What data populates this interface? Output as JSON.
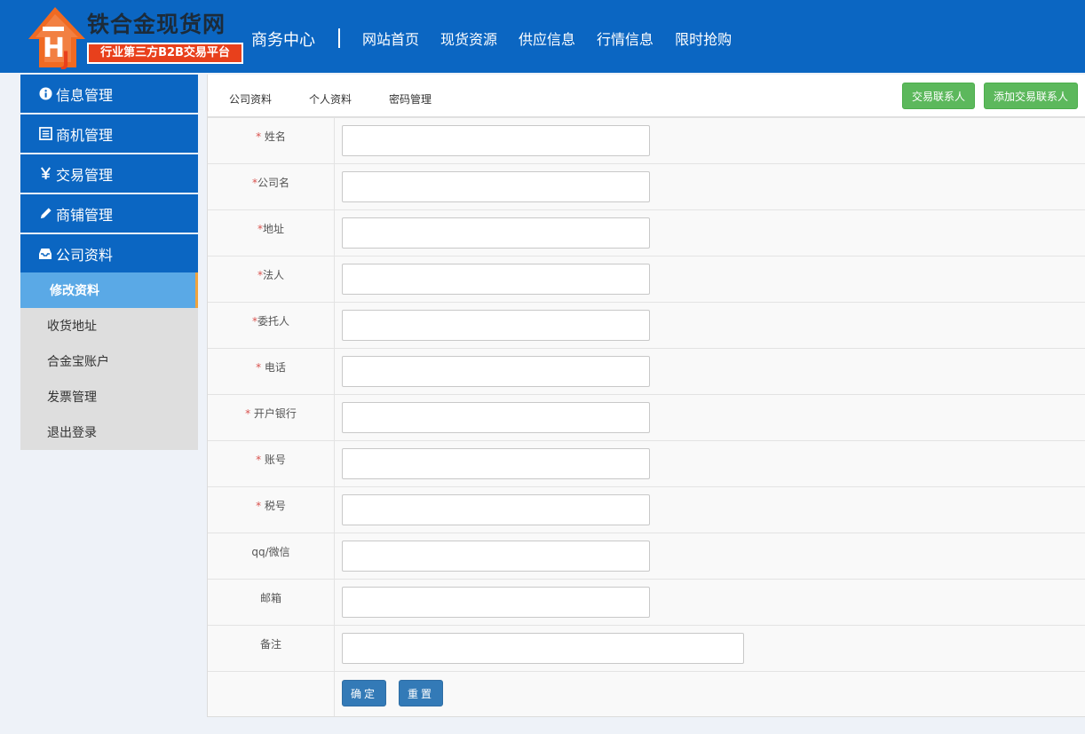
{
  "header": {
    "logo_title": "铁合金现货网",
    "logo_subtitle": "行业第三方B2B交易平台",
    "center_title": "商务中心",
    "nav": [
      "网站首页",
      "现货资源",
      "供应信息",
      "行情信息",
      "限时抢购"
    ],
    "brand_color": "#0b66c2",
    "logo_accent": "#e8401c"
  },
  "sidebar": {
    "sections": [
      {
        "label": "信息管理",
        "icon": "info-icon"
      },
      {
        "label": "商机管理",
        "icon": "list-icon"
      },
      {
        "label": "交易管理",
        "icon": "yen-icon"
      },
      {
        "label": "商铺管理",
        "icon": "pencil-icon"
      },
      {
        "label": "公司资料",
        "icon": "inbox-icon"
      }
    ],
    "sub_items": [
      "修改资料",
      "收货地址",
      "合金宝账户",
      "发票管理",
      "退出登录"
    ],
    "active_sub": "修改资料"
  },
  "tabs": [
    "公司资料",
    "个人资料",
    "密码管理"
  ],
  "actions": {
    "contact": "交易联系人",
    "add_contact": "添加交易联系人"
  },
  "form": {
    "fields": [
      {
        "label": "姓名",
        "required": true,
        "star": "* ",
        "value": ""
      },
      {
        "label": "公司名",
        "required": true,
        "star": "*",
        "value": ""
      },
      {
        "label": "地址",
        "required": true,
        "star": "*",
        "value": ""
      },
      {
        "label": "法人",
        "required": true,
        "star": "*",
        "value": ""
      },
      {
        "label": "委托人",
        "required": true,
        "star": "*",
        "value": ""
      },
      {
        "label": "电话",
        "required": true,
        "star": "* ",
        "value": ""
      },
      {
        "label": "开户银行",
        "required": true,
        "star": "* ",
        "value": ""
      },
      {
        "label": "账号",
        "required": true,
        "star": "* ",
        "value": ""
      },
      {
        "label": "税号",
        "required": true,
        "star": "* ",
        "value": ""
      },
      {
        "label": "qq/微信",
        "required": false,
        "star": "",
        "value": ""
      },
      {
        "label": "邮箱",
        "required": false,
        "star": "",
        "value": ""
      },
      {
        "label": "备注",
        "required": false,
        "star": "",
        "value": ""
      }
    ],
    "submit": "确定",
    "reset": "重置"
  }
}
